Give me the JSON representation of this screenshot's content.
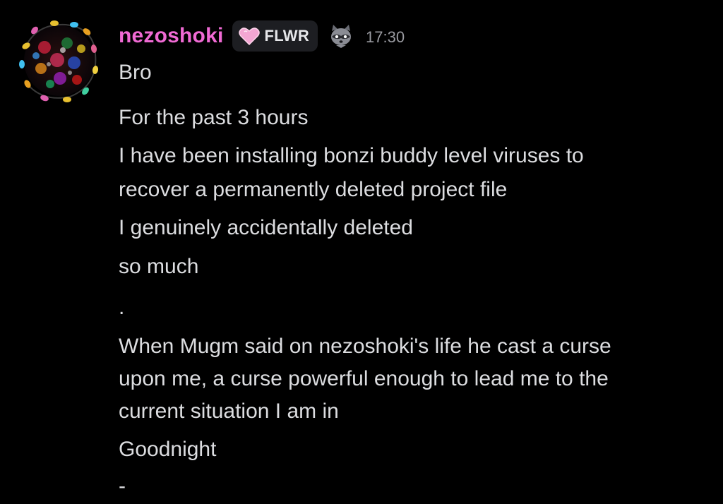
{
  "message": {
    "author": "nezoshoki",
    "tag": {
      "label": "FLWR",
      "icon": "pink-heart-icon"
    },
    "decoration_icon": "raccoon-icon",
    "timestamp": "17:30",
    "lines": [
      "Bro",
      "For the past 3 hours",
      "I have been installing bonzi buddy level viruses to",
      "recover a permanently deleted project file",
      "I genuinely accidentally deleted",
      "so much",
      ".",
      "When Mugm said on nezoshoki's life he cast a curse",
      "upon me, a curse powerful enough to lead me to the",
      "current situation I am in",
      "Goodnight",
      "-"
    ]
  },
  "colors": {
    "background": "#000000",
    "username": "#f06ad4",
    "text": "#dcdde0",
    "timestamp": "#9a9ba1",
    "tag_background": "#1d1e22",
    "tag_heart": "#f3a6d3"
  }
}
